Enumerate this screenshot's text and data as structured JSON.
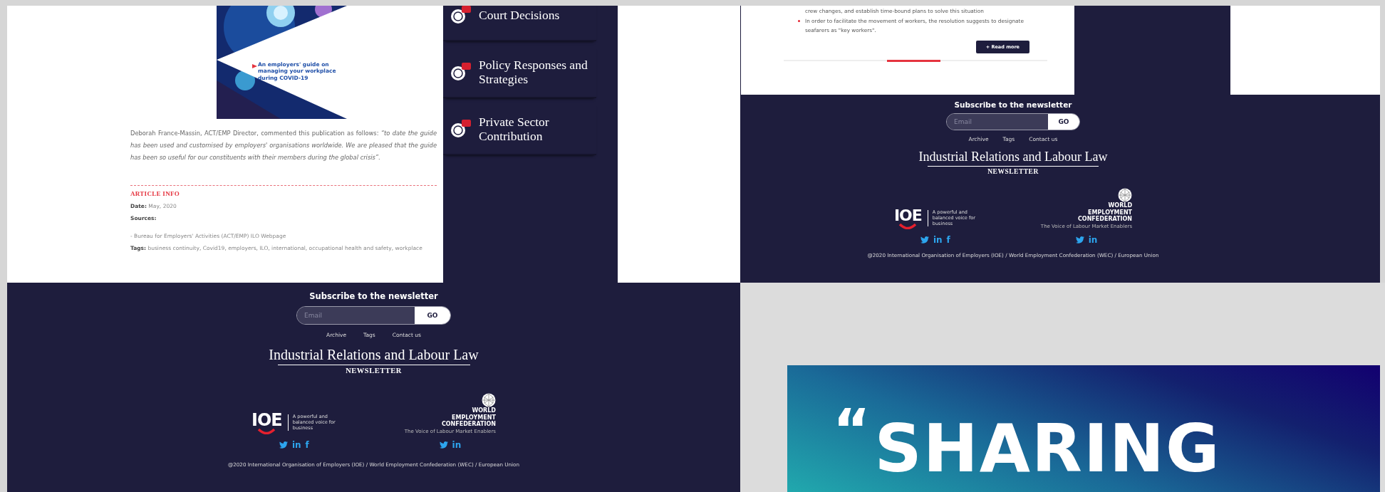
{
  "article": {
    "cover_caption": "An employers' guide on managing your workplace during COVID-19",
    "paragraph": "Deborah France-Massin, ACT/EMP Director, commented this publication as follows: *“to date the guide has been used and customised by employers' organisations worldwide.  We are pleased that the guide has been so useful for our constituents with their members during the global crisis”.*",
    "info_heading": "ARTICLE INFO",
    "date": "**Date:** May, 2020",
    "sources_label": "Sources:",
    "source": "- Bureau for Employers' Activities (ACT/EMP) ILO Webpage",
    "tags": "**Tags:** business continuity, Covid19, employers, ILO, international, occupational health and safety, workplace"
  },
  "sidebar": {
    "items": [
      {
        "label": "Court Decisions"
      },
      {
        "label": "Policy Responses and Strategies"
      },
      {
        "label": "Private Sector Contribution"
      }
    ]
  },
  "card": {
    "bullets": [
      {
        "text": "crew changes, and establish time-bound plans to solve this situation",
        "marker": false
      },
      {
        "text": "In order to facilitate the movement of workers, the resolution suggests to designate seafarers as \"key workers\".",
        "marker": true
      }
    ],
    "button": "+ Read more"
  },
  "footers": [
    {
      "subscribe": "Subscribe to the newsletter",
      "placeholder": "Email",
      "go": "GO",
      "links": [
        "Archive",
        "Tags",
        "Contact us"
      ],
      "title": "Industrial Relations and Labour Law",
      "subtitle": "NEWSLETTER",
      "ioe": "IOE",
      "ioe_tagline": "A powerful and balanced voice for business",
      "wec": "WORLD EMPLOYMENT CONFEDERATION",
      "wec_tagline": "The Voice of Labour Market Enablers",
      "ioe_social": [
        {
          "kind": "twitter"
        },
        {
          "kind": "glyph",
          "text": "in"
        },
        {
          "kind": "glyph",
          "text": "f"
        }
      ],
      "wec_social": [
        {
          "kind": "twitter"
        },
        {
          "kind": "glyph",
          "text": "in"
        }
      ],
      "copyright": "@2020 International Organisation of Employers (IOE) / World Employment Confederation (WEC) / European Union"
    },
    {
      "subscribe": "Subscribe to the newsletter",
      "placeholder": "Email",
      "go": "GO",
      "links": [
        "Archive",
        "Tags",
        "Contact us"
      ],
      "title": "Industrial Relations and Labour Law",
      "subtitle": "NEWSLETTER",
      "ioe": "IOE",
      "ioe_tagline": "A powerful and balanced voice for business",
      "wec": "WORLD EMPLOYMENT CONFEDERATION",
      "wec_tagline": "The Voice of Labour Market Enablers",
      "ioe_social": [
        {
          "kind": "twitter"
        },
        {
          "kind": "glyph",
          "text": "in"
        },
        {
          "kind": "glyph",
          "text": "f"
        }
      ],
      "wec_social": [
        {
          "kind": "twitter"
        },
        {
          "kind": "glyph",
          "text": "in"
        }
      ],
      "copyright": "@2020 International Organisation of Employers (IOE) / World Employment Confederation (WEC) / European Union"
    }
  ],
  "banner": {
    "quote_mark": "“",
    "text": "SHARING"
  }
}
